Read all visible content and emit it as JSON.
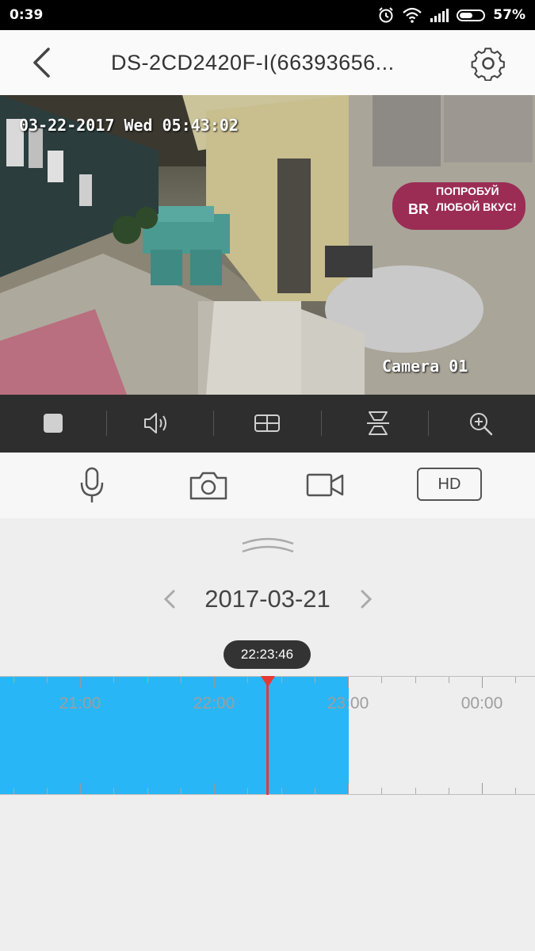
{
  "status_bar": {
    "time": "0:39",
    "battery": "57%",
    "battery_level": 0.57
  },
  "header": {
    "title": "DS-2CD2420F-I(66393656...",
    "back_icon": "chevron-left-icon",
    "settings_icon": "gear-icon"
  },
  "video": {
    "osd_datetime": "03-22-2017 Wed 05:43:02",
    "osd_camera": "Camera 01",
    "sign_line1": "ПОПРОБУЙ",
    "sign_line2": "ЛЮБОЙ ВКУС!",
    "sign_logo": "BR"
  },
  "playback_controls": {
    "icons": [
      "stop-icon",
      "speaker-icon",
      "grid-icon",
      "flip-icon",
      "zoom-in-icon"
    ]
  },
  "toolbar": {
    "icons": [
      "microphone-icon",
      "camera-icon",
      "video-record-icon"
    ],
    "quality_label": "HD"
  },
  "date_nav": {
    "date": "2017-03-21"
  },
  "timeline": {
    "current_time": "22:23:46",
    "hour_labels": [
      "21:00",
      "22:00",
      "23:00",
      "00:00"
    ],
    "recording_color": "#29b6f6",
    "cursor_color": "#e53935"
  }
}
